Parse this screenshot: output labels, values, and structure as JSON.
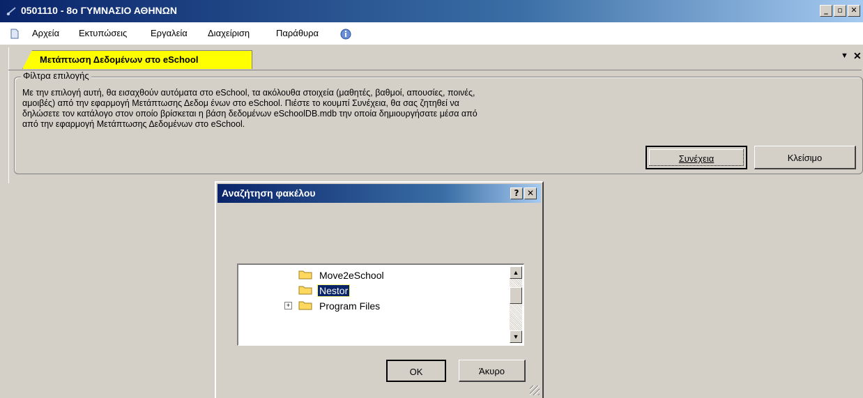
{
  "window": {
    "title": "0501110 - 8ο ΓΥΜΝΑΣΙΟ ΑΘΗΝΩΝ"
  },
  "menubar": {
    "items": [
      {
        "label": "Αρχεία"
      },
      {
        "label": "Εκτυπώσεις"
      },
      {
        "label": "Εργαλεία"
      },
      {
        "label": "Διαχείριση"
      },
      {
        "label": "Παράθυρα"
      }
    ]
  },
  "tab": {
    "label": "Μετάπτωση Δεδομένων στο eSchool"
  },
  "filter": {
    "legend": "Φίλτρα επιλογής",
    "lines": [
      "Με την επιλογή αυτή, θα εισαχθούν αυτόματα στο eSchool, τα ακόλουθα στοιχεία  (μαθητές, βαθμοί, απουσίες, ποινές,",
      "αμοιβές) από την εφαρμογή Μετάπτωσης Δεδομ ένων στο eSchool. Πιέστε το κουμπί Συνέχεια, θα σας ζητηθεί να",
      "δηλώσετε τον κατάλογο στον οποίο βρίσκεται η βάση δεδομένων  eSchoolDB.mdb την  οποία δημιουργήσατε μέσα από",
      "από την εφαρμογή Μετάπτωσης Δεδομένων στο eSchool."
    ],
    "continue_label": "Συνέχεια",
    "close_label": "Κλείσιμο"
  },
  "dialog": {
    "title": "Αναζήτηση φακέλου",
    "help_label": "?",
    "close_label": "✕",
    "folders": [
      {
        "label": "Move2eSchool",
        "selected": false,
        "expandable": false
      },
      {
        "label": "Nestor",
        "selected": true,
        "expandable": false
      },
      {
        "label": "Program Files",
        "selected": false,
        "expandable": true
      }
    ],
    "ok_label": "OK",
    "cancel_label": "Άκυρο"
  },
  "colors": {
    "tab_bg": "#ffff00",
    "titlebar": "#0a246a",
    "selection": "#0a246a"
  },
  "icons": [
    "app-icon",
    "menu-doc-icon",
    "info-icon",
    "tab-dropdown-icon",
    "tab-close-icon",
    "folder-icon",
    "expander-plus-icon",
    "scroll-up-icon",
    "scroll-down-icon",
    "resize-grip-icon"
  ]
}
